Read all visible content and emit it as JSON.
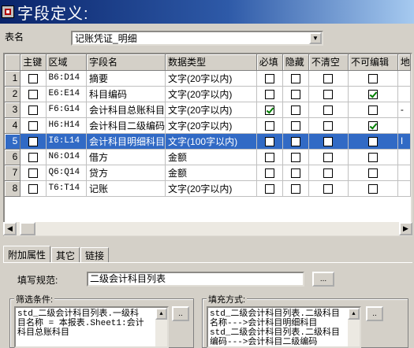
{
  "window": {
    "title": "字段定义:"
  },
  "table_name": {
    "label": "表名",
    "value": "记账凭证_明细"
  },
  "grid": {
    "columns": [
      "",
      "主键",
      "区域",
      "字段名",
      "数据类型",
      "必填",
      "隐藏",
      "不清空",
      "不可编辑",
      "地"
    ],
    "rows": [
      {
        "num": "1",
        "key": false,
        "range": "B6:D14",
        "name": "摘要",
        "type": "文字(20字以内)",
        "required": false,
        "hidden": false,
        "noclear": false,
        "readonly": false,
        "extra": ""
      },
      {
        "num": "2",
        "key": false,
        "range": "E6:E14",
        "name": "科目编码",
        "type": "文字(20字以内)",
        "required": false,
        "hidden": false,
        "noclear": false,
        "readonly": true,
        "extra": ""
      },
      {
        "num": "3",
        "key": false,
        "range": "F6:G14",
        "name": "会计科目总账科目",
        "type": "文字(20字以内)",
        "required": true,
        "hidden": false,
        "noclear": false,
        "readonly": false,
        "extra": "-"
      },
      {
        "num": "4",
        "key": false,
        "range": "H6:H14",
        "name": "会计科目二级编码",
        "type": "文字(20字以内)",
        "required": false,
        "hidden": false,
        "noclear": false,
        "readonly": true,
        "extra": ""
      },
      {
        "num": "5",
        "key": false,
        "range": "I6:L14",
        "name": "会计科目明细科目",
        "type": "文字(100字以内)",
        "required": false,
        "hidden": false,
        "noclear": false,
        "readonly": false,
        "extra": "I",
        "selected": true
      },
      {
        "num": "6",
        "key": false,
        "range": "N6:O14",
        "name": "借方",
        "type": "金额",
        "required": false,
        "hidden": false,
        "noclear": false,
        "readonly": false,
        "extra": ""
      },
      {
        "num": "7",
        "key": false,
        "range": "Q6:Q14",
        "name": "贷方",
        "type": "金额",
        "required": false,
        "hidden": false,
        "noclear": false,
        "readonly": false,
        "extra": ""
      },
      {
        "num": "8",
        "key": false,
        "range": "T6:T14",
        "name": "记账",
        "type": "文字(20字以内)",
        "required": false,
        "hidden": false,
        "noclear": false,
        "readonly": false,
        "extra": ""
      }
    ]
  },
  "tabs": [
    {
      "label": "附加属性",
      "active": true
    },
    {
      "label": "其它",
      "active": false
    },
    {
      "label": "链接",
      "active": false
    }
  ],
  "fill_rule": {
    "label": "填写规范:",
    "value": "二级会计科目列表",
    "button": "..."
  },
  "filter": {
    "title": "筛选条件:",
    "lines": [
      "std_二级会计科目列表.一级科",
      "目名称 = 本报表.Sheet1:会计",
      "科目总账科目"
    ],
    "button": ".."
  },
  "fill_method": {
    "title": "填充方式:",
    "lines": [
      "std_二级会计科目列表.二级科目",
      "名称--->会计科目明细科目",
      "std_二级会计科目列表.二级科目",
      "编码--->会计科目二级编码"
    ],
    "button": ".."
  }
}
